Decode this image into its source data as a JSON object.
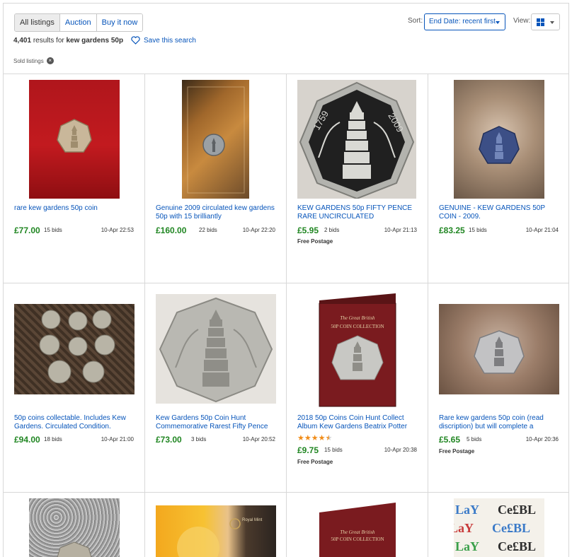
{
  "toolbar": {
    "tabs": [
      "All listings",
      "Auction",
      "Buy it now"
    ],
    "sort_label": "Sort:",
    "sort_value": "End Date: recent first",
    "view_label": "View:",
    "view_icon": "grid-icon"
  },
  "summary": {
    "count": "4,401",
    "results_text": "results for",
    "query": "kew gardens 50p",
    "save_search": "Save this search",
    "filter_chip": "Sold listings"
  },
  "listings": [
    {
      "title": "rare kew gardens 50p coin",
      "price": "£77.00",
      "bids": "15 bids",
      "date": "10-Apr 22:53",
      "postage": ""
    },
    {
      "title": "Genuine 2009 circulated kew gardens 50p with 15 brilliantly",
      "price": "£160.00",
      "bids": "22 bids",
      "date": "10-Apr 22:20",
      "postage": ""
    },
    {
      "title": "KEW GARDENS 50p FIFTY PENCE RARE UNCIRCULATED",
      "price": "£5.95",
      "bids": "2 bids",
      "date": "10-Apr 21:13",
      "postage": "Free Postage"
    },
    {
      "title": "GENUINE - KEW GARDENS 50P COIN - 2009.",
      "price": "£83.25",
      "bids": "15 bids",
      "date": "10-Apr 21:04",
      "postage": ""
    },
    {
      "title": "50p coins collectable. Includes Kew Gardens. Circulated Condition.",
      "price": "£94.00",
      "bids": "18 bids",
      "date": "10-Apr 21:00",
      "postage": ""
    },
    {
      "title": "Kew Gardens 50p Coin Hunt Commemorative Rarest Fifty Pence",
      "price": "£73.00",
      "bids": "3 bids",
      "date": "10-Apr 20:52",
      "postage": ""
    },
    {
      "title": "2018 50p Coins Coin Hunt Collect Album Kew Gardens Beatrix Potter",
      "price": "£9.75",
      "bids": "15 bids",
      "date": "10-Apr 20:38",
      "postage": "Free Postage",
      "rating": 4.5
    },
    {
      "title": "Rare kew gardens 50p coin (read discription) but will complete a",
      "price": "£5.65",
      "bids": "5 bids",
      "date": "10-Apr 20:36",
      "postage": "Free Postage"
    }
  ],
  "image_text": {
    "coin_year": "1759",
    "coin_value": "2009",
    "album_line1": "The Great British",
    "album_line2": "50P COIN COLLECTION",
    "royal_mint": "Royal Mint"
  }
}
